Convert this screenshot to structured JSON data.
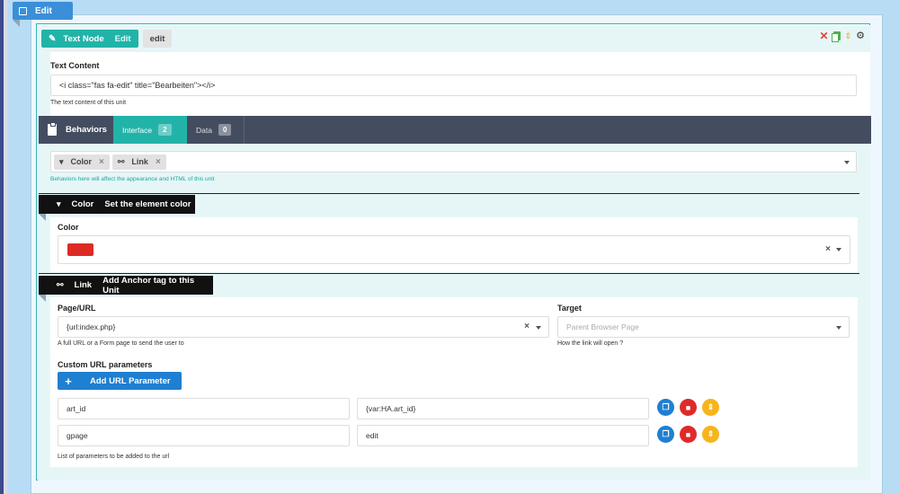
{
  "edit_tab": {
    "label": "Edit"
  },
  "node": {
    "type_label": "Text Node",
    "edit_label": "Edit",
    "edit_button": "edit"
  },
  "text_content": {
    "label": "Text Content",
    "value": "<i class=\"fas fa-edit\" title=\"Bearbeiten\"></i>",
    "help": "The text content of this unit"
  },
  "behaviors": {
    "title": "Behaviors",
    "tabs": [
      {
        "label": "Interface",
        "count": "2"
      },
      {
        "label": "Data",
        "count": "0"
      }
    ],
    "tags": [
      {
        "label": "Color",
        "icon": "paint-roller-icon"
      },
      {
        "label": "Link",
        "icon": "link-icon"
      }
    ],
    "help": "Behaviors here will affect the appearance and HTML of this unit"
  },
  "color_section": {
    "title": "Color",
    "subtitle": "Set the element color",
    "field_label": "Color",
    "swatch_color": "#dd2a24"
  },
  "link_section": {
    "title": "Link",
    "subtitle": "Add Anchor tag to this Unit",
    "page_url": {
      "label": "Page/URL",
      "value": "{url:index.php}",
      "help": "A full URL or a Form page to send the user to"
    },
    "target": {
      "label": "Target",
      "placeholder": "Parent Browser Page",
      "help": "How the link will open ?"
    },
    "params_label": "Custom URL parameters",
    "add_button": "Add URL Parameter",
    "params": [
      {
        "name": "art_id",
        "value": "{var:HA.art_id}"
      },
      {
        "name": "gpage",
        "value": "edit"
      }
    ],
    "params_help": "List of parameters to be added to the url"
  },
  "colors": {
    "outer": "#b9dcf5",
    "primary": "#1f7fd1",
    "teal": "#22b3a8",
    "behaviors_bar": "#444d60",
    "danger": "#e02a2a",
    "warning": "#f6b41d"
  }
}
